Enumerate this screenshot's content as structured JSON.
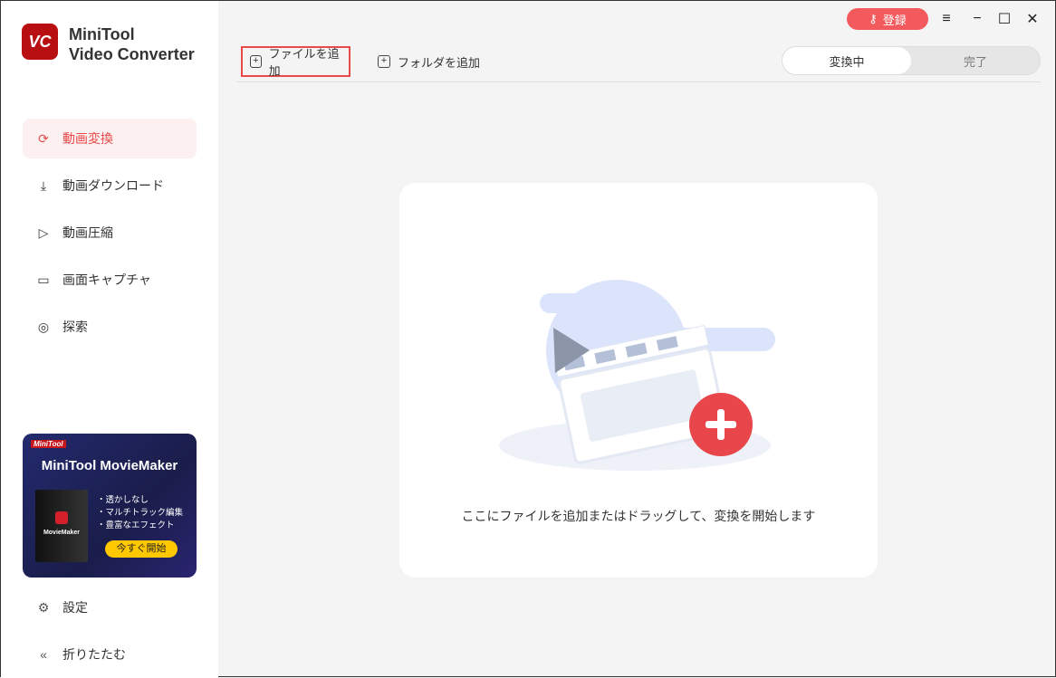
{
  "app": {
    "logo_text": "VC",
    "name_line1": "MiniTool",
    "name_line2": "Video Converter"
  },
  "sidebar": {
    "items": [
      {
        "label": "動画変換",
        "icon": "convert-icon"
      },
      {
        "label": "動画ダウンロード",
        "icon": "download-icon"
      },
      {
        "label": "動画圧縮",
        "icon": "compress-icon"
      },
      {
        "label": "画面キャプチャ",
        "icon": "camera-icon"
      },
      {
        "label": "探索",
        "icon": "compass-icon"
      }
    ],
    "promo": {
      "badge": "MiniTool",
      "title": "MiniTool MovieMaker",
      "box_label": "MovieMaker",
      "features": [
        "・透かしなし",
        "・マルチトラック編集",
        "・豊富なエフェクト"
      ],
      "cta": "今すぐ開始"
    },
    "settings": "設定",
    "collapse": "折りたたむ"
  },
  "toolbar": {
    "add_file": "ファイルを追加",
    "add_folder": "フォルダを追加"
  },
  "tabs": {
    "converting": "変換中",
    "done": "完了"
  },
  "titlebar": {
    "register": "登録"
  },
  "dropzone": {
    "message": "ここにファイルを追加またはドラッグして、変換を開始します"
  },
  "colors": {
    "accent": "#e84a4a",
    "register": "#f35a5e"
  }
}
